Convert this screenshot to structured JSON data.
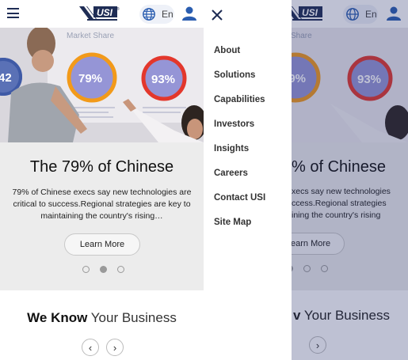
{
  "header": {
    "logo_text": "USI",
    "logo_mark": "®",
    "language": "En",
    "icons": {
      "menu": "hamburger-icon",
      "language": "globe-icon",
      "account": "user-icon",
      "close": "close-icon"
    }
  },
  "hero": {
    "board_title": "Market Share",
    "stat_left": "42",
    "stat_center": "79%",
    "stat_right": "93%"
  },
  "slide": {
    "title": "The 79% of Chinese",
    "body": "79% of Chinese execs say new technologies are critical to success.Regional strategies are key to maintaining the country's rising…",
    "button": "Learn More",
    "dots": 3,
    "active_dot": 2
  },
  "know": {
    "bold": "We Know",
    "rest": "Your Business",
    "prev": "‹",
    "next": "›"
  },
  "menu": {
    "items": [
      "About",
      "Solutions",
      "Capabilities",
      "Investors",
      "Insights",
      "Careers",
      "Contact USI",
      "Site Map"
    ]
  },
  "ghost": {
    "title_fragment": "% of Chinese",
    "body_fragment": "xecs say new technologies\nccess.Regional strategies\nining the country's rising",
    "button_fragment": "earn More",
    "know_fragment_bold": "v",
    "know_fragment_rest": "Your Business",
    "board_title_fragment": "Share"
  },
  "colors": {
    "brand_navy": "#1f2d55",
    "brand_blue": "#2a5db0",
    "overlay": "#28326e",
    "ring_orange": "#f29a1a",
    "ring_red": "#e3372c"
  }
}
